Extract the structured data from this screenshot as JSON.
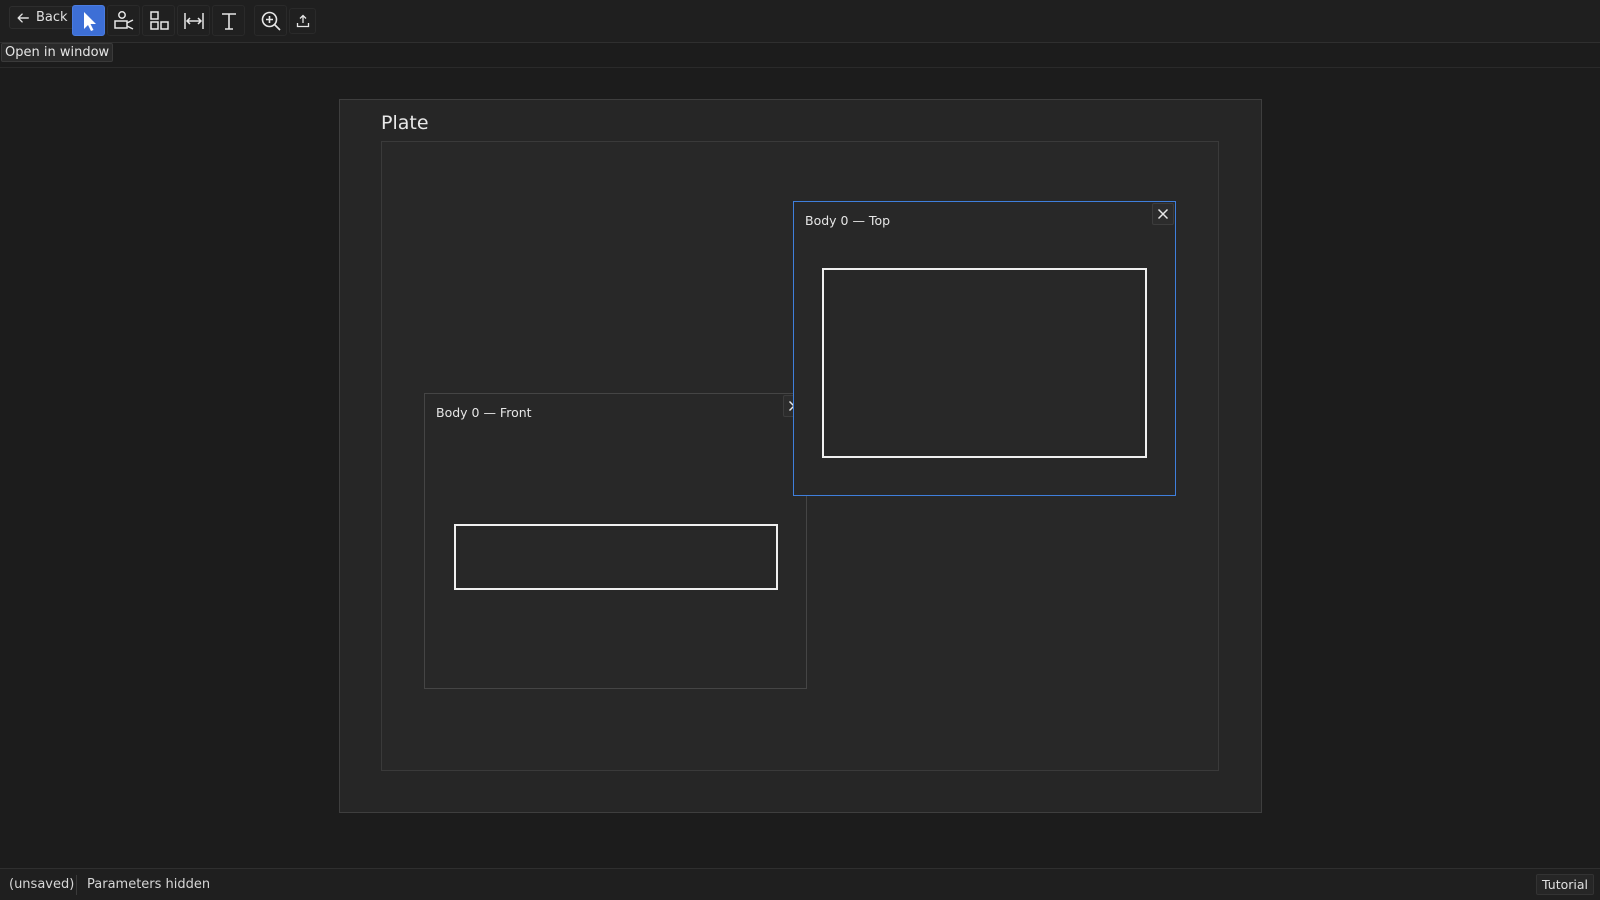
{
  "toolbar": {
    "back_label": "Back",
    "tools": [
      {
        "name": "select",
        "icon": "cursor-arrow-icon",
        "active": true
      },
      {
        "name": "view",
        "icon": "camera-view-icon",
        "active": false
      },
      {
        "name": "arrange",
        "icon": "shapes-icon",
        "active": false
      },
      {
        "name": "dimension",
        "icon": "dimension-icon",
        "active": false
      },
      {
        "name": "text",
        "icon": "text-cursor-icon",
        "active": false
      },
      {
        "name": "zoom",
        "icon": "zoom-in-icon",
        "active": false
      },
      {
        "name": "export",
        "icon": "upload-icon",
        "active": false
      }
    ]
  },
  "subbar": {
    "open_window_label": "Open in window"
  },
  "plate": {
    "title": "Plate",
    "views": [
      {
        "id": "front",
        "title": "Body 0 — Front",
        "selected": false
      },
      {
        "id": "top",
        "title": "Body 0 — Top",
        "selected": true
      }
    ]
  },
  "status": {
    "save_state": "(unsaved)",
    "parameters": "Parameters hidden",
    "tutorial_label": "Tutorial"
  },
  "colors": {
    "accent": "#3f7fdc",
    "background": "#1c1c1c",
    "plate": "#262626",
    "shape_stroke": "#efefef"
  }
}
